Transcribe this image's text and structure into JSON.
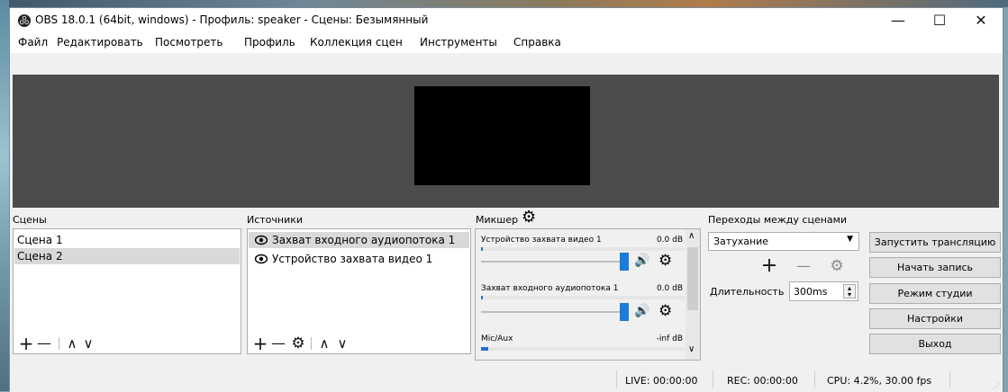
{
  "window": {
    "title": "OBS 18.0.1 (64bit, windows) - Профиль: speaker - Сцены: Безымянный",
    "controls": {
      "minimize": "—",
      "maximize": "☐",
      "close": "✕"
    }
  },
  "menu": [
    "Файл",
    "Редактировать",
    "Посмотреть",
    "Профиль",
    "Коллекция сцен",
    "Инструменты",
    "Справка"
  ],
  "scenes": {
    "label": "Сцены",
    "items": [
      "Сцена 1",
      "Сцена 2"
    ],
    "selected": "Сцена 2"
  },
  "sources": {
    "label": "Источники",
    "items": [
      "Захват входного аудиопотока 1",
      "Устройство захвата видео 1"
    ],
    "selected": "Захват входного аудиопотока 1"
  },
  "mixer": {
    "label": "Микшер",
    "channels": [
      {
        "name": "Устройство захвата видео 1",
        "db": "0.0 dB",
        "level": 0.0
      },
      {
        "name": "Захват входного аудиопотока 1",
        "db": "0.0 dB",
        "level": 0.0
      },
      {
        "name": "Mic/Aux",
        "db": "-inf dB",
        "level": 0.0
      }
    ]
  },
  "transitions": {
    "label": "Переходы между сценами",
    "selected": "Затухание",
    "duration_label": "Длительность",
    "duration_value": "300ms"
  },
  "controls": {
    "start_stream": "Запустить трансляцию",
    "start_record": "Начать запись",
    "studio_mode": "Режим студии",
    "settings": "Настройки",
    "exit": "Выход"
  },
  "status": {
    "live": "LIVE: 00:00:00",
    "rec": "REC: 00:00:00",
    "cpu": "CPU: 4.2%, 30.00 fps"
  },
  "icons": {
    "add": "+",
    "remove": "—",
    "up": "∧",
    "down": "∨",
    "gear": "⚙",
    "eye": "👁",
    "speaker": "🔊"
  },
  "colors": {
    "preview_bg": "#4c4c4c",
    "canvas": "#000000",
    "selection": "#d9d9d9",
    "volume_handle": "#1a7cd8",
    "meter": "#2b6cd4"
  }
}
